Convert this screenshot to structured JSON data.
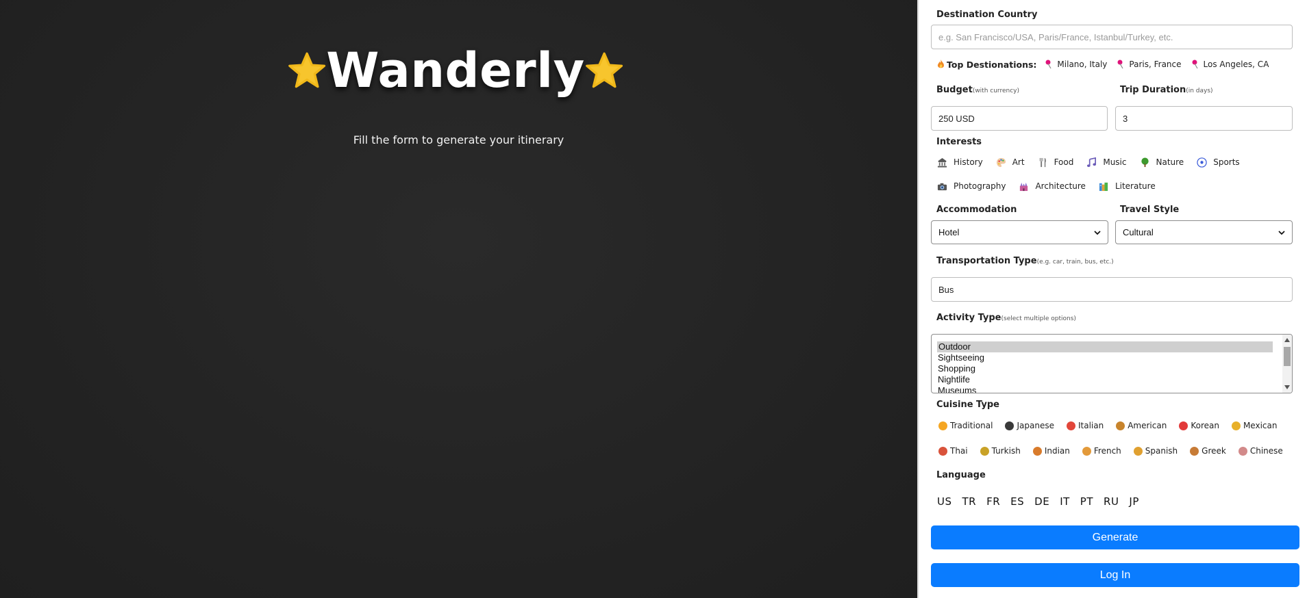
{
  "brand": {
    "title": "Wanderly",
    "subtitle": "Fill the form to generate your itinerary"
  },
  "form": {
    "destination": {
      "label": "Destination Country",
      "placeholder": "e.g. San Francisco/USA, Paris/France, Istanbul/Turkey, etc.",
      "value": ""
    },
    "top_destinations": {
      "label": "Top Destionations:",
      "items": [
        "Milano, Italy",
        "Paris, France",
        "Los Angeles, CA"
      ]
    },
    "budget": {
      "label": "Budget",
      "hint": "(with currency)",
      "value": "250 USD"
    },
    "duration": {
      "label": "Trip Duration",
      "hint": "(in days)",
      "value": "3"
    },
    "interests": {
      "label": "Interests",
      "row1": [
        {
          "label": "History",
          "icon": "bank-icon"
        },
        {
          "label": "Art",
          "icon": "palette-icon"
        },
        {
          "label": "Food",
          "icon": "fork-knife-icon"
        },
        {
          "label": "Music",
          "icon": "music-note-icon"
        },
        {
          "label": "Nature",
          "icon": "tree-icon"
        },
        {
          "label": "Sports",
          "icon": "soccer-ball-icon"
        }
      ],
      "row2": [
        {
          "label": "Photography",
          "icon": "camera-icon"
        },
        {
          "label": "Architecture",
          "icon": "castle-icon"
        },
        {
          "label": "Literature",
          "icon": "books-icon"
        }
      ]
    },
    "accommodation": {
      "label": "Accommodation",
      "selected": "Hotel"
    },
    "travel_style": {
      "label": "Travel Style",
      "selected": "Cultural"
    },
    "transportation": {
      "label": "Transportation Type",
      "hint": "(e.g. car, train, bus, etc.)",
      "value": "Bus"
    },
    "activity": {
      "label": "Activity Type",
      "hint": "(select multiple options)",
      "options": [
        "Outdoor",
        "Sightseeing",
        "Shopping",
        "Nightlife",
        "Museums"
      ],
      "selected": "Outdoor"
    },
    "cuisine": {
      "label": "Cuisine Type",
      "row1": [
        {
          "label": "Traditional",
          "color": "#f5a623"
        },
        {
          "label": "Japanese",
          "color": "#3a3a3a"
        },
        {
          "label": "Italian",
          "color": "#e2463a"
        },
        {
          "label": "American",
          "color": "#c8842c"
        },
        {
          "label": "Korean",
          "color": "#e23a3a"
        },
        {
          "label": "Mexican",
          "color": "#e8b02a"
        }
      ],
      "row2": [
        {
          "label": "Thai",
          "color": "#d9533b"
        },
        {
          "label": "Turkish",
          "color": "#c9a227"
        },
        {
          "label": "Indian",
          "color": "#d97b2b"
        },
        {
          "label": "French",
          "color": "#e39a3a"
        },
        {
          "label": "Spanish",
          "color": "#e0a030"
        },
        {
          "label": "Greek",
          "color": "#c77b36"
        },
        {
          "label": "Chinese",
          "color": "#d28a8a"
        }
      ]
    },
    "language": {
      "label": "Language",
      "codes": [
        "US",
        "TR",
        "FR",
        "ES",
        "DE",
        "IT",
        "PT",
        "RU",
        "JP"
      ]
    },
    "buttons": {
      "generate": "Generate",
      "login": "Log In"
    }
  },
  "colors": {
    "accent": "#0a7cff",
    "background_dark": "#232323",
    "star": "#f7c52d"
  }
}
